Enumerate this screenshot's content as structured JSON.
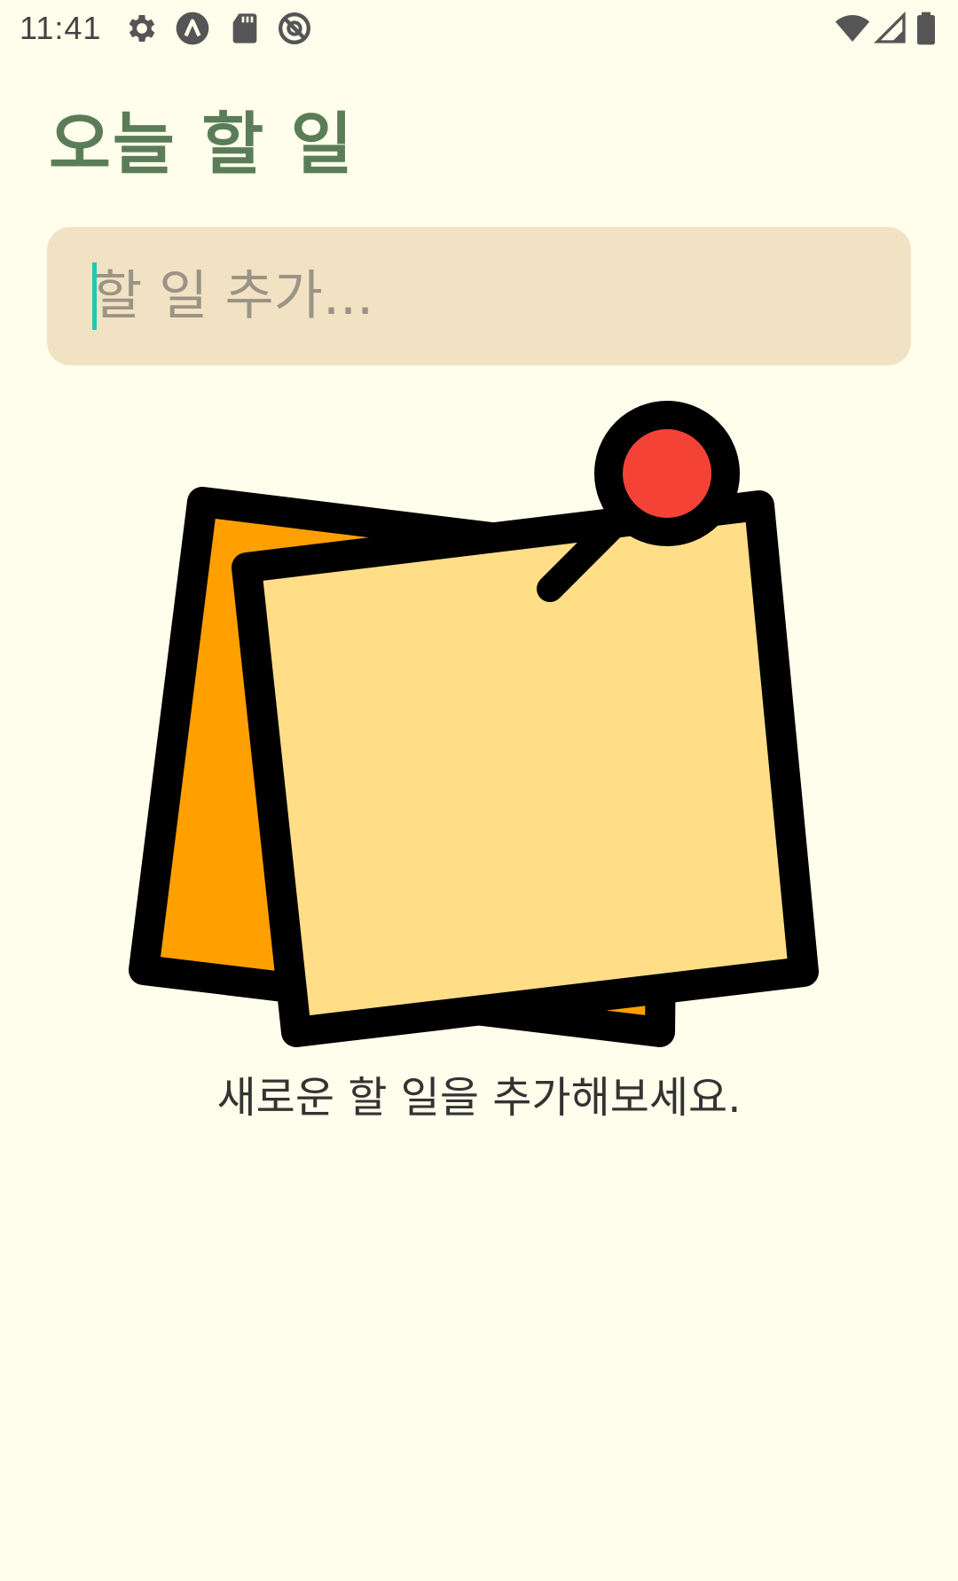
{
  "status_bar": {
    "time": "11:41",
    "left_icons": [
      "gear-icon",
      "a-logo-icon",
      "sd-card-icon",
      "no-sync-icon"
    ],
    "right_icons": [
      "wifi-icon",
      "signal-icon",
      "battery-icon"
    ]
  },
  "header": {
    "title": "오늘 할 일"
  },
  "todo_input": {
    "placeholder": "할 일 추가...",
    "value": ""
  },
  "empty_state": {
    "illustration": "sticky-note-pin-icon",
    "message": "새로운 할 일을 추가해보세요."
  },
  "colors": {
    "background": "#FFFDEB",
    "title": "#5A7D58",
    "input_background": "#F1E2C3",
    "placeholder": "#9B9486",
    "cursor": "#1FC7B4",
    "note_back": "#FFA000",
    "note_front": "#FFDE87",
    "pin": "#F44336"
  }
}
